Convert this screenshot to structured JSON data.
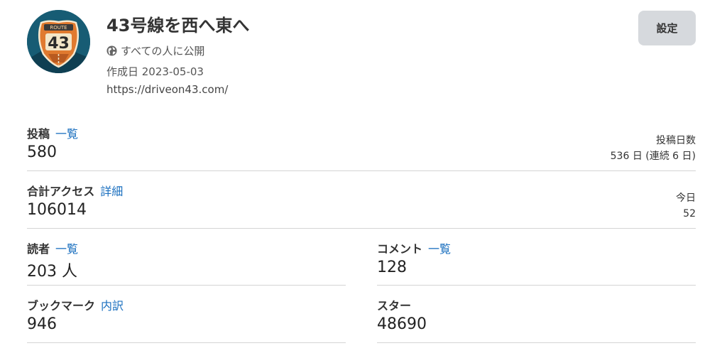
{
  "header": {
    "avatar_text": "43",
    "avatar_badge_text": "ROUTE",
    "title": "43号線を西へ東へ",
    "visibility": "すべての人に公開",
    "created": "作成日 2023-05-03",
    "url": "https://driveon43.com/",
    "settings_label": "設定"
  },
  "stats": {
    "posts": {
      "label": "投稿",
      "link": "一覧",
      "value": "580",
      "side_label": "投稿日数",
      "side_value": "536 日 (連続 6 日)"
    },
    "access": {
      "label": "合計アクセス",
      "link": "詳細",
      "value": "106014",
      "side_label": "今日",
      "side_value": "52"
    },
    "readers": {
      "label": "読者",
      "link": "一覧",
      "value": "203 人"
    },
    "comments": {
      "label": "コメント",
      "link": "一覧",
      "value": "128"
    },
    "bookmarks": {
      "label": "ブックマーク",
      "link": "内訳",
      "value": "946"
    },
    "stars": {
      "label": "スター",
      "value": "48690"
    }
  },
  "colors": {
    "link": "#1a6fbf",
    "button_bg": "#d6d9dd",
    "avatar_bg": "#175c74"
  }
}
